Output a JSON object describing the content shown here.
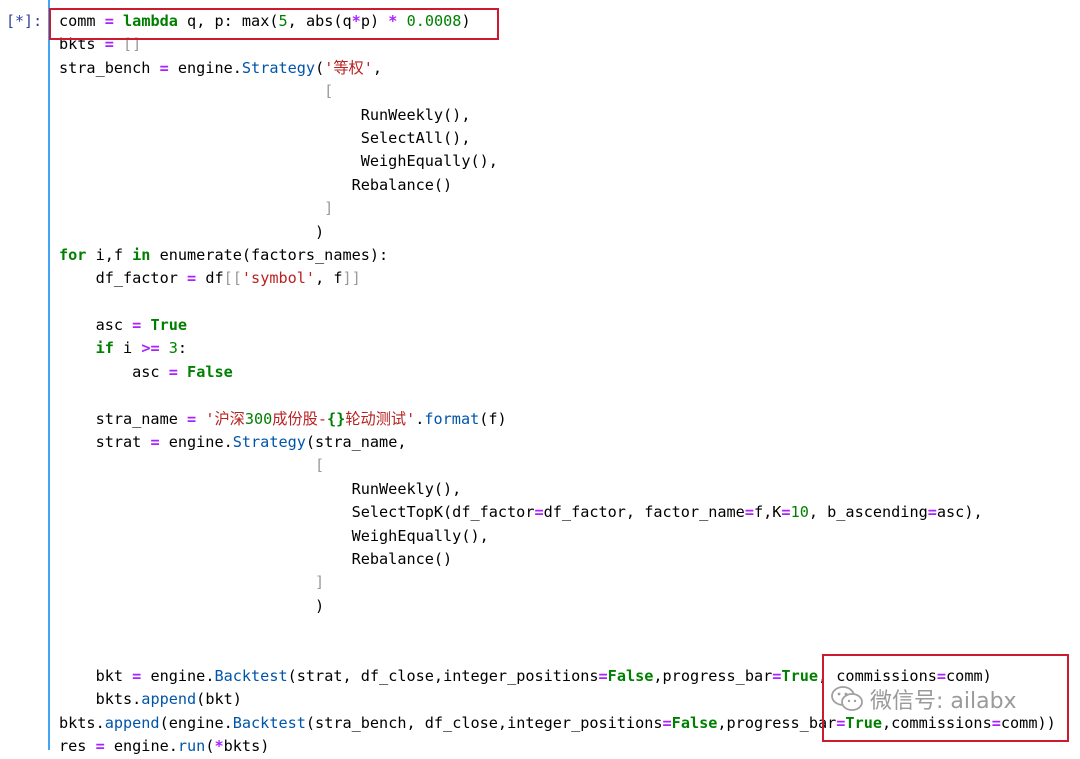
{
  "prompt": "[*]:",
  "watermark": {
    "text": "微信号: ailabx",
    "icon": "wechat-icon"
  },
  "code": {
    "lines": [
      [
        {
          "t": "comm "
        },
        {
          "t": "=",
          "c": "op"
        },
        {
          "t": " "
        },
        {
          "t": "lambda",
          "c": "kw"
        },
        {
          "t": " q, p: max("
        },
        {
          "t": "5",
          "c": "num"
        },
        {
          "t": ", abs(q"
        },
        {
          "t": "*",
          "c": "op"
        },
        {
          "t": "p) "
        },
        {
          "t": "*",
          "c": "op"
        },
        {
          "t": " "
        },
        {
          "t": "0.0008",
          "c": "num"
        },
        {
          "t": ")"
        }
      ],
      [
        {
          "t": "bkts "
        },
        {
          "t": "=",
          "c": "op"
        },
        {
          "t": " "
        },
        {
          "t": "[]",
          "c": "br"
        }
      ],
      [
        {
          "t": "stra_bench "
        },
        {
          "t": "=",
          "c": "op"
        },
        {
          "t": " engine."
        },
        {
          "t": "Strategy",
          "c": "attr"
        },
        {
          "t": "("
        },
        {
          "t": "'等权'",
          "c": "str"
        },
        {
          "t": ","
        }
      ],
      [
        {
          "t": "                             "
        },
        {
          "t": "[",
          "c": "br"
        }
      ],
      [
        {
          "t": "                                 RunWeekly(),"
        }
      ],
      [
        {
          "t": "                                 SelectAll(),"
        }
      ],
      [
        {
          "t": "                                 WeighEqually(),"
        }
      ],
      [
        {
          "t": "                                Rebalance()"
        }
      ],
      [
        {
          "t": "                             "
        },
        {
          "t": "]",
          "c": "br"
        }
      ],
      [
        {
          "t": "                            )"
        }
      ],
      [
        {
          "t": "for",
          "c": "kw"
        },
        {
          "t": " i,f "
        },
        {
          "t": "in",
          "c": "kw"
        },
        {
          "t": " enumerate(factors_names):"
        }
      ],
      [
        {
          "t": "    df_factor "
        },
        {
          "t": "=",
          "c": "op"
        },
        {
          "t": " df"
        },
        {
          "t": "[[",
          "c": "br"
        },
        {
          "t": "'symbol'",
          "c": "str"
        },
        {
          "t": ", f"
        },
        {
          "t": "]]",
          "c": "br"
        }
      ],
      [
        {
          "t": ""
        }
      ],
      [
        {
          "t": "    asc "
        },
        {
          "t": "=",
          "c": "op"
        },
        {
          "t": " "
        },
        {
          "t": "True",
          "c": "kwc"
        }
      ],
      [
        {
          "t": "    "
        },
        {
          "t": "if",
          "c": "kw"
        },
        {
          "t": " i "
        },
        {
          "t": ">=",
          "c": "op"
        },
        {
          "t": " "
        },
        {
          "t": "3",
          "c": "num"
        },
        {
          "t": ":"
        }
      ],
      [
        {
          "t": "        asc "
        },
        {
          "t": "=",
          "c": "op"
        },
        {
          "t": " "
        },
        {
          "t": "False",
          "c": "kwc"
        }
      ],
      [
        {
          "t": ""
        }
      ],
      [
        {
          "t": "    stra_name "
        },
        {
          "t": "=",
          "c": "op"
        },
        {
          "t": " "
        },
        {
          "t": "'沪深",
          "c": "str"
        },
        {
          "t": "300",
          "c": "num"
        },
        {
          "t": "成份股-",
          "c": "str"
        },
        {
          "t": "{}",
          "c": "kw"
        },
        {
          "t": "轮动测试'",
          "c": "str"
        },
        {
          "t": "."
        },
        {
          "t": "format",
          "c": "attr"
        },
        {
          "t": "(f)"
        }
      ],
      [
        {
          "t": "    strat "
        },
        {
          "t": "=",
          "c": "op"
        },
        {
          "t": " engine."
        },
        {
          "t": "Strategy",
          "c": "attr"
        },
        {
          "t": "(stra_name,"
        }
      ],
      [
        {
          "t": "                            "
        },
        {
          "t": "[",
          "c": "br"
        }
      ],
      [
        {
          "t": "                                RunWeekly(),"
        }
      ],
      [
        {
          "t": "                                SelectTopK(df_factor"
        },
        {
          "t": "=",
          "c": "op"
        },
        {
          "t": "df_factor, factor_name"
        },
        {
          "t": "=",
          "c": "op"
        },
        {
          "t": "f,K"
        },
        {
          "t": "=",
          "c": "op"
        },
        {
          "t": "10",
          "c": "num"
        },
        {
          "t": ", b_ascending"
        },
        {
          "t": "=",
          "c": "op"
        },
        {
          "t": "asc),"
        }
      ],
      [
        {
          "t": "                                WeighEqually(),"
        }
      ],
      [
        {
          "t": "                                Rebalance()"
        }
      ],
      [
        {
          "t": "                            "
        },
        {
          "t": "]",
          "c": "br"
        }
      ],
      [
        {
          "t": "                            )"
        }
      ],
      [
        {
          "t": ""
        }
      ],
      [
        {
          "t": ""
        }
      ],
      [
        {
          "t": "    bkt "
        },
        {
          "t": "=",
          "c": "op"
        },
        {
          "t": " engine."
        },
        {
          "t": "Backtest",
          "c": "attr"
        },
        {
          "t": "(strat, df_close,integer_positions"
        },
        {
          "t": "=",
          "c": "op"
        },
        {
          "t": "False",
          "c": "kwc"
        },
        {
          "t": ",progress_bar"
        },
        {
          "t": "=",
          "c": "op"
        },
        {
          "t": "True",
          "c": "kwc"
        },
        {
          "t": ", commissions"
        },
        {
          "t": "=",
          "c": "op"
        },
        {
          "t": "comm)"
        }
      ],
      [
        {
          "t": "    bkts."
        },
        {
          "t": "append",
          "c": "attr"
        },
        {
          "t": "(bkt)"
        }
      ],
      [
        {
          "t": "bkts."
        },
        {
          "t": "append",
          "c": "attr"
        },
        {
          "t": "(engine."
        },
        {
          "t": "Backtest",
          "c": "attr"
        },
        {
          "t": "(stra_bench, df_close,integer_positions"
        },
        {
          "t": "=",
          "c": "op"
        },
        {
          "t": "False",
          "c": "kwc"
        },
        {
          "t": ",progress_bar"
        },
        {
          "t": "=",
          "c": "op"
        },
        {
          "t": "True",
          "c": "kwc"
        },
        {
          "t": ",commissions"
        },
        {
          "t": "=",
          "c": "op"
        },
        {
          "t": "comm))"
        }
      ],
      [
        {
          "t": "res "
        },
        {
          "t": "=",
          "c": "op"
        },
        {
          "t": " engine."
        },
        {
          "t": "run",
          "c": "attr"
        },
        {
          "t": "("
        },
        {
          "t": "*",
          "c": "op"
        },
        {
          "t": "bkts)"
        }
      ]
    ]
  }
}
